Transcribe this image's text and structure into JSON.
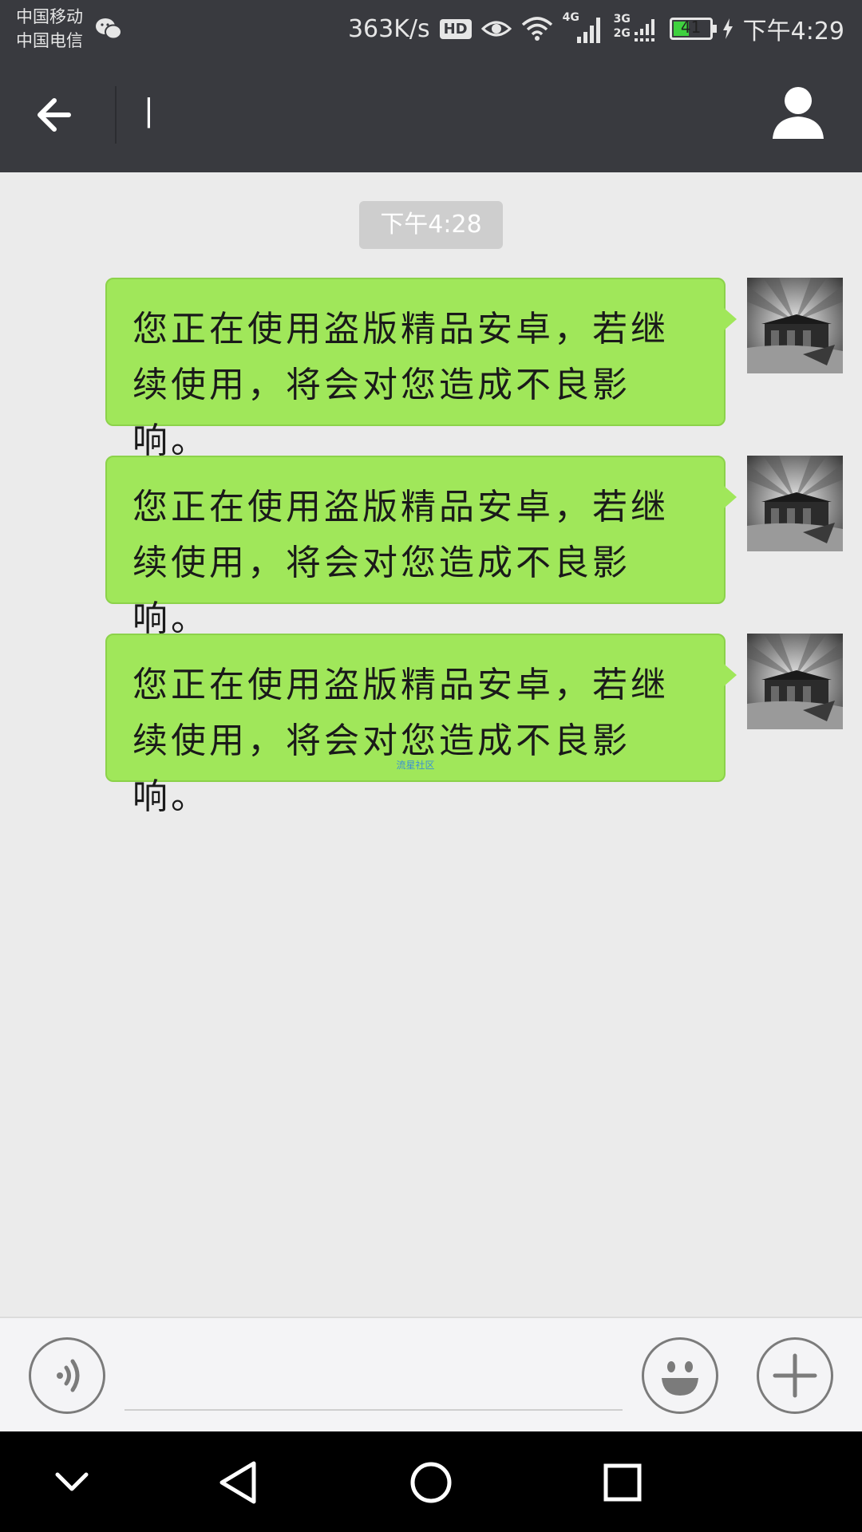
{
  "status_bar": {
    "carrier_1": "中国移动",
    "carrier_2": "中国电信",
    "speed": "363K/s",
    "hd_badge": "HD",
    "network_4g": "4G",
    "network_3g": "3G",
    "network_2g": "2G",
    "battery_level": "41",
    "time": "下午4:29",
    "icons": [
      "wechat-icon",
      "eye-icon",
      "wifi-icon",
      "signal-icon",
      "battery-icon",
      "charging-icon"
    ]
  },
  "title_bar": {
    "title": "|",
    "back_icon": "back-arrow-icon",
    "contact_icon": "person-icon"
  },
  "chat": {
    "timestamp": "下午4:28",
    "messages": [
      {
        "text": "您正在使用盗版精品安卓，若继续使用，将会对您造成不良影响。",
        "sender": "self"
      },
      {
        "text": "您正在使用盗版精品安卓，若继续使用，将会对您造成不良影响。",
        "sender": "self"
      },
      {
        "text": "您正在使用盗版精品安卓，若继续使用，将会对您造成不良影响。",
        "sender": "self",
        "watermark": "流星社区"
      }
    ]
  },
  "input_bar": {
    "value": "",
    "placeholder": "",
    "icons": [
      "voice-icon",
      "emoji-icon",
      "plus-icon"
    ]
  },
  "nav_bar": {
    "icons": [
      "notification-pulldown-icon",
      "back-triangle-icon",
      "home-circle-icon",
      "recents-square-icon"
    ]
  },
  "colors": {
    "header_bg": "#393a3f",
    "chat_bg": "#ebebeb",
    "bubble_green": "#a0e75a",
    "battery_green": "#3fd13f"
  }
}
